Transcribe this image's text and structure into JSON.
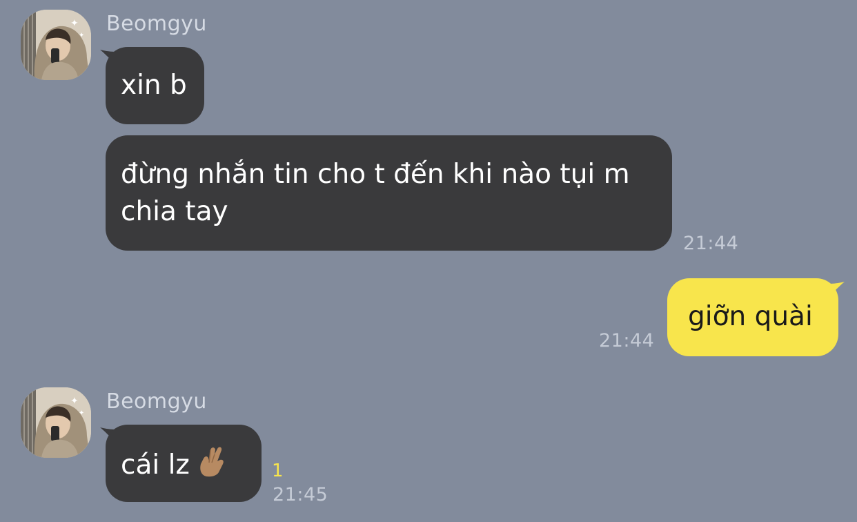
{
  "colors": {
    "background": "#828b9c",
    "incoming_bubble": "#3a3a3c",
    "outgoing_bubble": "#f8e54c",
    "unread_count": "#f8e54c"
  },
  "messages": [
    {
      "sender": "Beomgyu",
      "avatar": "profile-photo",
      "text": "xin b"
    },
    {
      "text_line1": "đừng nhắn tin cho t đến khi nào tụi m",
      "text_line2": "chia tay",
      "time": "21:44"
    },
    {
      "outgoing": true,
      "text": "giỡn quài",
      "time": "21:44"
    },
    {
      "sender": "Beomgyu",
      "avatar": "profile-photo",
      "text": "cái lz",
      "emoji": "crossed-fingers-icon",
      "unread": "1",
      "time": "21:45"
    }
  ]
}
